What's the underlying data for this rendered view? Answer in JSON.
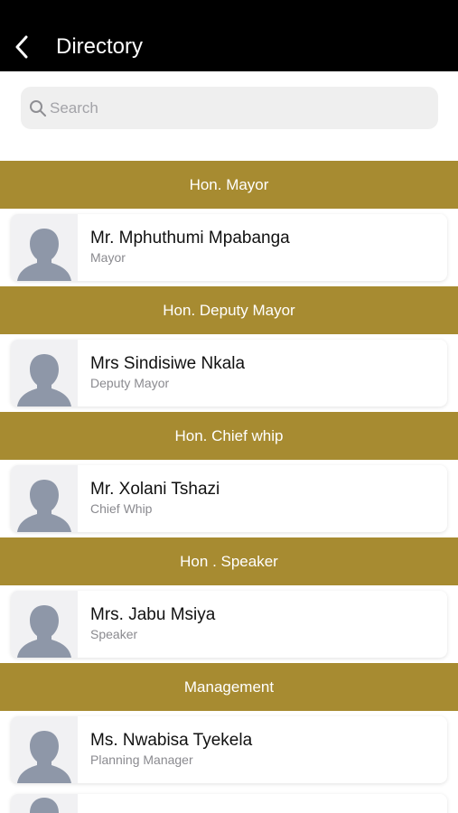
{
  "header": {
    "title": "Directory"
  },
  "search": {
    "placeholder": "Search",
    "value": ""
  },
  "sections": [
    {
      "title": "Hon. Mayor",
      "person": {
        "name": "Mr. Mphuthumi Mpabanga",
        "role": "Mayor"
      }
    },
    {
      "title": "Hon. Deputy Mayor",
      "person": {
        "name": "Mrs Sindisiwe Nkala",
        "role": "Deputy Mayor"
      }
    },
    {
      "title": "Hon. Chief whip",
      "person": {
        "name": "Mr. Xolani Tshazi",
        "role": "Chief Whip"
      }
    },
    {
      "title": "Hon . Speaker",
      "person": {
        "name": "Mrs. Jabu Msiya",
        "role": "Speaker"
      }
    },
    {
      "title": "Management",
      "person": {
        "name": "Ms. Nwabisa Tyekela",
        "role": "Planning Manager"
      }
    }
  ],
  "colors": {
    "header_bg": "#000000",
    "section_bg": "#a78b31",
    "avatar_fill": "#8e97a8"
  },
  "icons": {
    "back": "chevron-left-icon",
    "search": "search-icon",
    "avatar": "person-placeholder-icon"
  }
}
